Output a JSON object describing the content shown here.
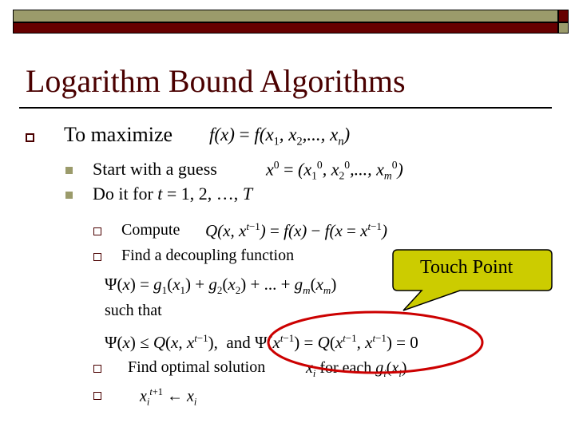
{
  "slide": {
    "title": "Logarithm Bound Algorithms",
    "colors": {
      "olive": "#9b9b6b",
      "maroon": "#660000",
      "title": "#4a0000",
      "callout_fill": "#cccc00",
      "ellipse": "#cc0000"
    },
    "bullets": [
      {
        "text": "To maximize",
        "math": "f(x) = f(x1, x2, ..., xn)"
      }
    ],
    "sub_bullets": [
      {
        "text": "Start with a guess",
        "math": "x0 = (x1^0, x2^0, ..., xm^0)"
      },
      {
        "text_pre": "Do it for ",
        "var": "t",
        "text_post": " = 1, 2, …, ",
        "var2": "T"
      }
    ],
    "steps": [
      {
        "text": "Compute",
        "math": "Q(x, x^{t-1}) = f(x) - f(x = x^{t-1})"
      },
      {
        "text": "Find a decoupling function"
      },
      {
        "text": "Find optimal solution",
        "math": "x_i for each g_i(x_i)"
      },
      {
        "text": "",
        "math": "x_i^{t+1} ← x_i"
      }
    ],
    "psi_formula": "Ψ(x) = g1(x1) + g2(x2) + ... + gm(xm)",
    "such_that": "such that",
    "condition": "Ψ(x) ≤ Q(x, x^{t-1}), and Ψ(x^{t-1}) = Q(x^{t-1}, x^{t-1}) = 0",
    "callout": {
      "label": "Touch Point"
    }
  }
}
